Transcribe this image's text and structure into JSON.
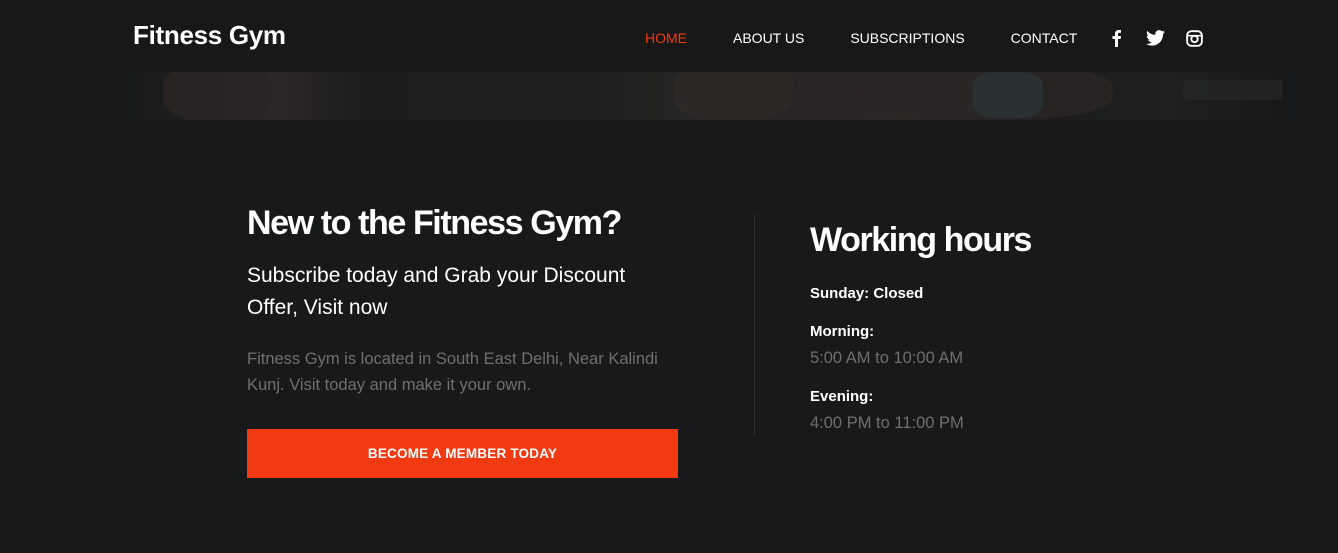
{
  "header": {
    "brand": "Fitness Gym",
    "nav": [
      {
        "label": "HOME",
        "active": true
      },
      {
        "label": "ABOUT US",
        "active": false
      },
      {
        "label": "SUBSCRIPTIONS",
        "active": false
      },
      {
        "label": "CONTACT",
        "active": false
      }
    ],
    "social": [
      "facebook-icon",
      "twitter-icon",
      "instagram-icon"
    ]
  },
  "promo": {
    "title": "New to the Fitness Gym?",
    "subtitle": "Subscribe today and Grab your Discount Offer, Visit now",
    "description": "Fitness Gym is located in South East Delhi, Near Kalindi Kunj. Visit today and make it your own.",
    "cta_label": "BECOME A MEMBER TODAY"
  },
  "hours": {
    "title": "Working hours",
    "sunday": "Sunday: Closed",
    "morning_label": "Morning:",
    "morning_value": "5:00 AM to 10:00 AM",
    "evening_label": "Evening:",
    "evening_value": "4:00 PM to 11:00 PM"
  },
  "colors": {
    "background": "#18191b",
    "accent": "#f13a12",
    "muted_text": "#6f6f6f"
  }
}
